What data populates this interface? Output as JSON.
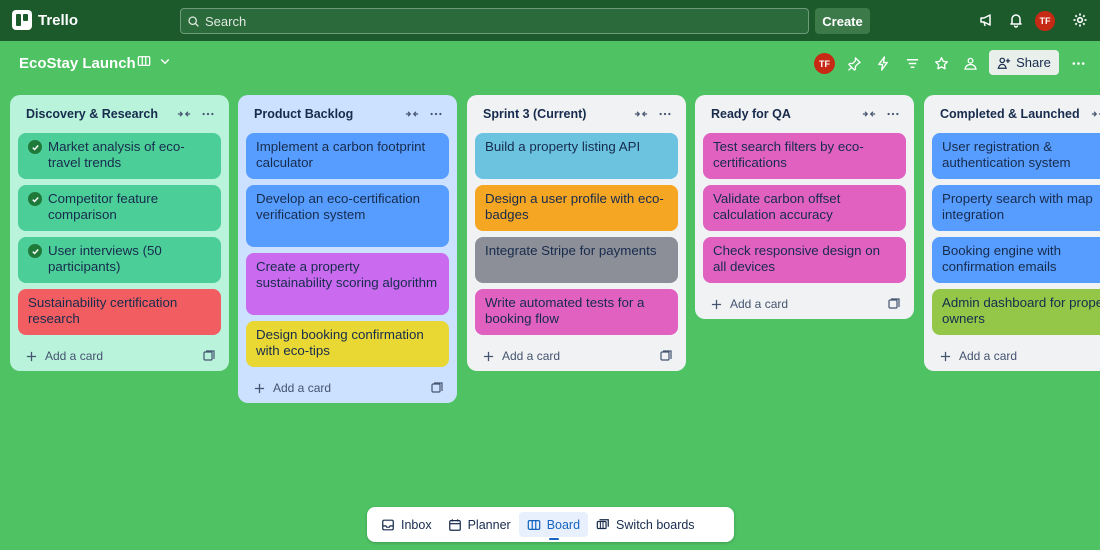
{
  "app": {
    "name": "Trello"
  },
  "topnav": {
    "search_placeholder": "Search",
    "create_label": "Create",
    "user_initials": "TF"
  },
  "board": {
    "title": "EcoStay Launch",
    "view_icon": "board-view-icon",
    "share_label": "Share",
    "member_initials": "TF"
  },
  "lists": [
    {
      "title": "Discovery & Research",
      "bg": "#baf3db",
      "cards": [
        {
          "text": "Market analysis of eco-travel trends",
          "color": "#4bce97",
          "done": true
        },
        {
          "text": "Competitor feature comparison",
          "color": "#4bce97",
          "done": true
        },
        {
          "text": "User interviews (50 participants)",
          "color": "#4bce97",
          "done": true
        },
        {
          "text": "Sustainability certification research",
          "color": "#f15d61",
          "done": false
        }
      ],
      "add_label": "Add a card"
    },
    {
      "title": "Product Backlog",
      "bg": "#cce0ff",
      "cards": [
        {
          "text": "Implement a carbon footprint calculator",
          "color": "#579dff",
          "done": false
        },
        {
          "text": "Develop an eco-certification verification system",
          "color": "#579dff",
          "done": false
        },
        {
          "text": "Create a property sustainability scoring algorithm",
          "color": "#c96aef",
          "done": false
        },
        {
          "text": "Design booking confirmation with eco-tips",
          "color": "#e9d833",
          "done": false
        }
      ],
      "add_label": "Add a card"
    },
    {
      "title": "Sprint 3 (Current)",
      "bg": "#f1f2f4",
      "cards": [
        {
          "text": "Build a property listing API",
          "color": "#6cc3e0",
          "done": false
        },
        {
          "text": "Design a user profile with eco-badges",
          "color": "#f5a623",
          "done": false
        },
        {
          "text": "Integrate Stripe for payments",
          "color": "#8c8f97",
          "done": false
        },
        {
          "text": "Write automated tests for a booking flow",
          "color": "#e061c0",
          "done": false
        }
      ],
      "add_label": "Add a card"
    },
    {
      "title": "Ready for QA",
      "bg": "#f1f2f4",
      "cards": [
        {
          "text": "Test search filters by eco-certifications",
          "color": "#e061c0",
          "done": false
        },
        {
          "text": "Validate carbon offset calculation accuracy",
          "color": "#e061c0",
          "done": false
        },
        {
          "text": "Check responsive design on all devices",
          "color": "#e061c0",
          "done": false
        }
      ],
      "add_label": "Add a card"
    },
    {
      "title": "Completed & Launched",
      "bg": "#f1f2f4",
      "cards": [
        {
          "text": "User registration & authentication system",
          "color": "#579dff",
          "done": false
        },
        {
          "text": "Property search with map integration",
          "color": "#579dff",
          "done": false
        },
        {
          "text": "Booking engine with confirmation emails",
          "color": "#579dff",
          "done": false
        },
        {
          "text": "Admin dashboard for property owners",
          "color": "#94c748",
          "done": false
        }
      ],
      "add_label": "Add a card"
    }
  ],
  "bottombar": {
    "items": [
      {
        "label": "Inbox",
        "icon": "inbox-icon"
      },
      {
        "label": "Planner",
        "icon": "calendar-icon"
      },
      {
        "label": "Board",
        "icon": "board-icon",
        "active": true
      },
      {
        "label": "Switch boards",
        "icon": "switch-boards-icon"
      }
    ]
  }
}
